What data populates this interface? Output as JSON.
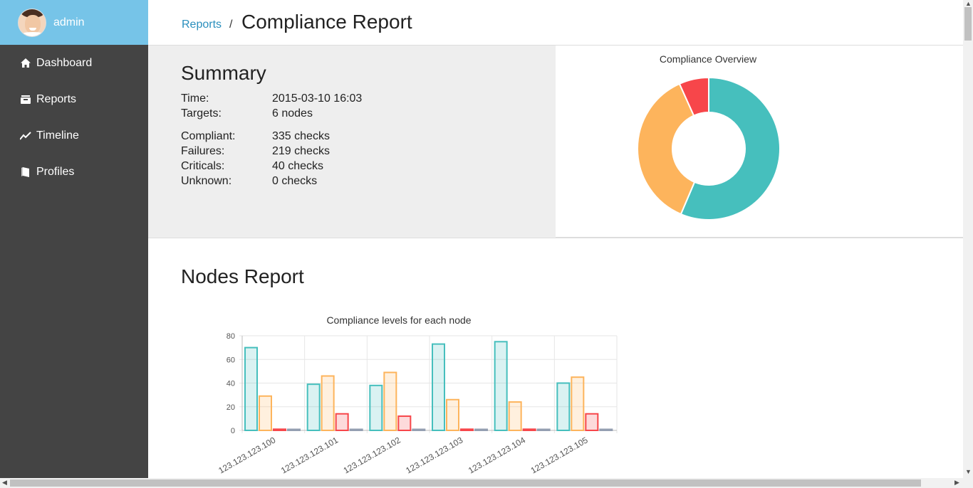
{
  "user": {
    "name": "admin"
  },
  "nav": [
    {
      "label": "Dashboard",
      "icon": "home-icon"
    },
    {
      "label": "Reports",
      "icon": "inbox-icon"
    },
    {
      "label": "Timeline",
      "icon": "timeline-icon"
    },
    {
      "label": "Profiles",
      "icon": "book-icon"
    }
  ],
  "breadcrumb": {
    "parent": "Reports",
    "separator": "/",
    "title": "Compliance Report"
  },
  "summary": {
    "heading": "Summary",
    "rows": [
      {
        "key": "Time:",
        "value": "2015-03-10 16:03"
      },
      {
        "key": "Targets:",
        "value": "6 nodes"
      },
      {
        "key": "Compliant:",
        "value": "335 checks"
      },
      {
        "key": "Failures:",
        "value": "219 checks"
      },
      {
        "key": "Criticals:",
        "value": "40 checks"
      },
      {
        "key": "Unknown:",
        "value": "0 checks"
      }
    ]
  },
  "nodes_heading": "Nodes Report",
  "colors": {
    "compliant": "#46bfbd",
    "failure": "#fdb45c",
    "critical": "#f7464a",
    "unknown": "#949fb1"
  },
  "chart_data": [
    {
      "type": "pie",
      "title": "Compliance Overview",
      "labels": [],
      "values": [
        335,
        219,
        40,
        0
      ]
    },
    {
      "type": "bar",
      "title": "Compliance levels for each node",
      "categories": [
        "123.123.123.100",
        "123.123.123.101",
        "123.123.123.102",
        "123.123.123.103",
        "123.123.123.104",
        "123.123.123.105"
      ],
      "series": [
        {
          "values": [
            70,
            39,
            38,
            73,
            75,
            40
          ]
        },
        {
          "values": [
            29,
            46,
            49,
            26,
            24,
            45
          ]
        },
        {
          "values": [
            1,
            14,
            12,
            1,
            1,
            14
          ]
        },
        {
          "values": [
            0,
            0,
            0,
            0,
            0,
            0
          ]
        }
      ],
      "yticks": [
        "0",
        "20",
        "40",
        "60",
        "80"
      ],
      "ylim": [
        0,
        80
      ]
    }
  ]
}
